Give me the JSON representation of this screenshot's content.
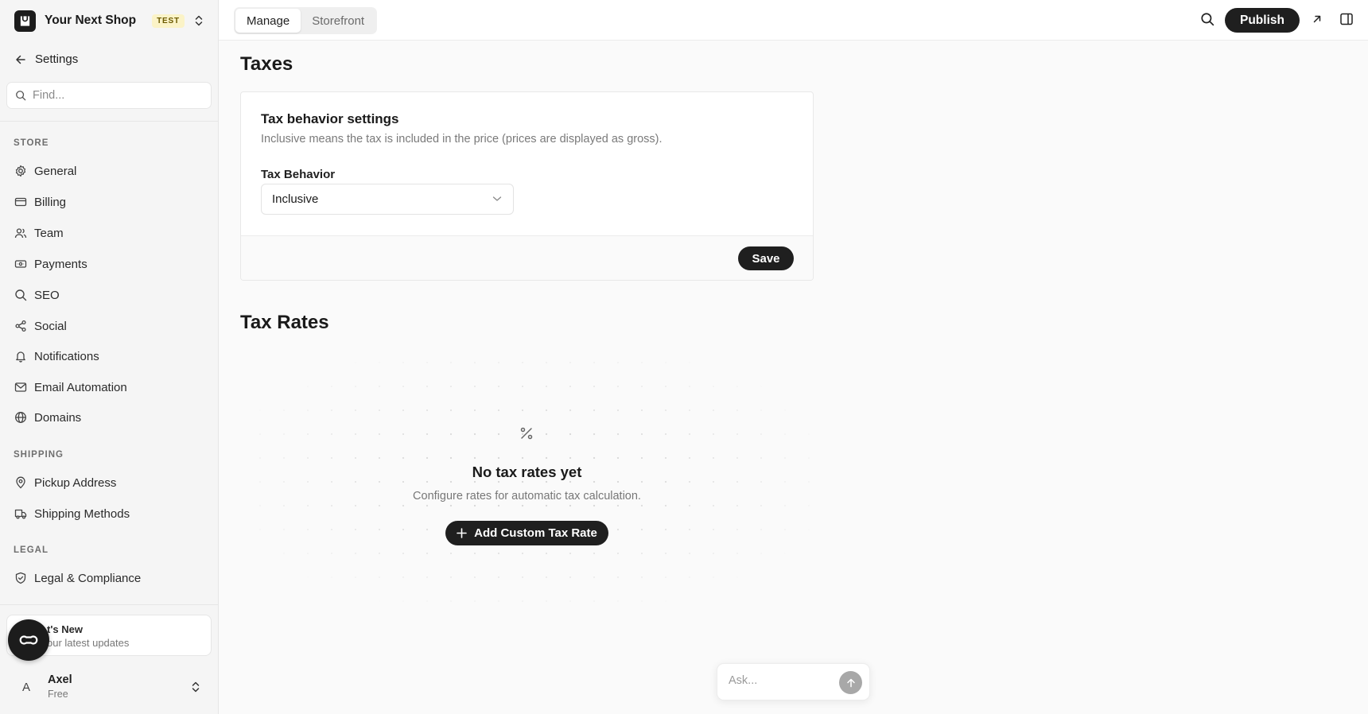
{
  "shop": {
    "name": "Your Next Shop",
    "badge": "TEST"
  },
  "sidebar": {
    "back_label": "Settings",
    "search_placeholder": "Find...",
    "sections": {
      "store": "STORE",
      "shipping": "SHIPPING",
      "legal": "LEGAL"
    },
    "items": {
      "general": "General",
      "billing": "Billing",
      "team": "Team",
      "payments": "Payments",
      "seo": "SEO",
      "social": "Social",
      "notifications": "Notifications",
      "email_automation": "Email Automation",
      "domains": "Domains",
      "pickup_address": "Pickup Address",
      "shipping_methods": "Shipping Methods",
      "legal_compliance": "Legal & Compliance"
    },
    "whats_new": {
      "title": "t's New",
      "subtitle": "our latest updates"
    },
    "user": {
      "initial": "A",
      "name": "Axel",
      "plan": "Free"
    }
  },
  "topbar": {
    "tabs": [
      "Manage",
      "Storefront"
    ],
    "active_tab": "Manage",
    "publish_label": "Publish"
  },
  "main": {
    "title": "Taxes",
    "card": {
      "title": "Tax behavior settings",
      "description": "Inclusive means the tax is included in the price (prices are displayed as gross).",
      "field_label": "Tax Behavior",
      "select_value": "Inclusive",
      "save_label": "Save"
    },
    "tax_rates": {
      "title": "Tax Rates",
      "empty_title": "No tax rates yet",
      "empty_description": "Configure rates for automatic tax calculation.",
      "add_label": "Add Custom Tax Rate"
    },
    "ask_placeholder": "Ask..."
  },
  "icons": {
    "shop_logo": "bag-icon",
    "search": "search-icon",
    "settings": "gear-icon",
    "billing": "credit-card-icon",
    "team": "users-icon",
    "payments": "banknote-icon",
    "seo": "search-icon",
    "social": "share-icon",
    "notifications": "bell-icon",
    "email": "mail-icon",
    "domains": "globe-icon",
    "pickup": "map-pin-icon",
    "shipping": "truck-icon",
    "legal": "shield-check-icon",
    "percent": "percent-icon"
  },
  "colors": {
    "primary": "#1f1f1f",
    "badge_bg": "#fbf3c7",
    "badge_text": "#6b5a00",
    "background": "#fafafa"
  }
}
